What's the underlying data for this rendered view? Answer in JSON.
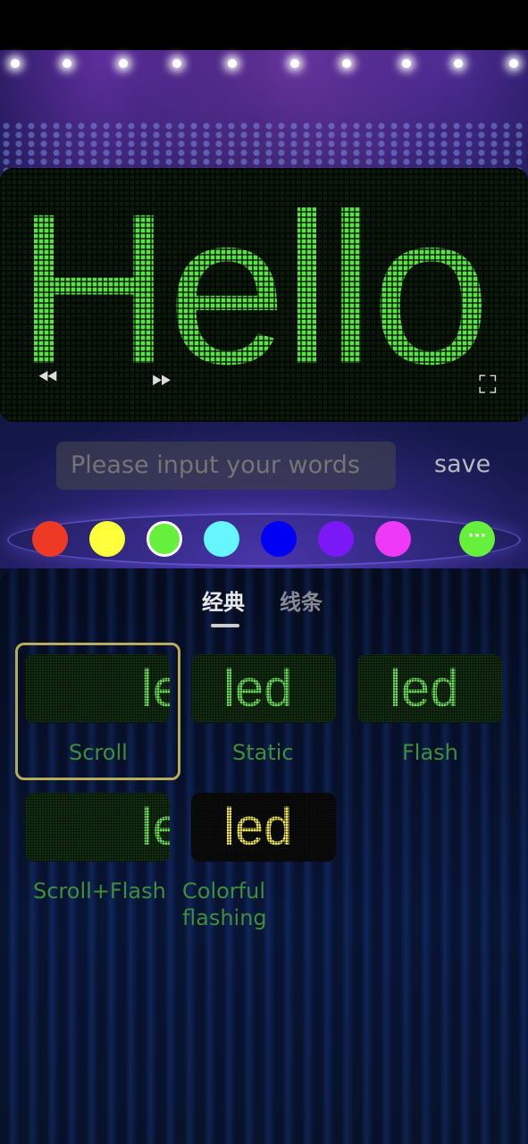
{
  "display": {
    "text": "Hello",
    "color": "#5de04a"
  },
  "input": {
    "placeholder": "Please input your words",
    "value": ""
  },
  "save_label": "save",
  "colors": [
    "#ee3a24",
    "#ffff3c",
    "#66f03c",
    "#66f6ff",
    "#0000f4",
    "#7a18f6",
    "#ee3af6"
  ],
  "selected_color": "#66f03c",
  "more_label": "···",
  "tabs": [
    {
      "label": "经典",
      "active": true
    },
    {
      "label": "线条",
      "active": false
    }
  ],
  "modes": [
    {
      "label": "Scroll",
      "preview": "le",
      "selected": true
    },
    {
      "label": "Static",
      "preview": "led"
    },
    {
      "label": "Flash",
      "preview": "led"
    },
    {
      "label": "Scroll+Flash",
      "preview": "le"
    },
    {
      "label": "Colorful flashing",
      "preview": "led"
    }
  ],
  "icons": [
    "rewind-icon",
    "fast-forward-icon",
    "fullscreen-icon",
    "more-icon"
  ]
}
